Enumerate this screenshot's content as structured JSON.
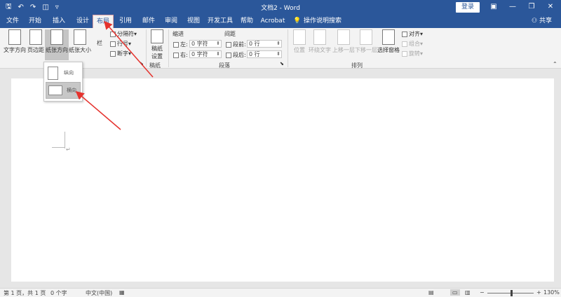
{
  "window": {
    "title": "文档2 - Word",
    "login_label": "登录",
    "quick_access": [
      "save-icon",
      "undo-icon",
      "redo-icon",
      "touch-mode-icon",
      "customize-icon"
    ],
    "controls": [
      "ribbon-display-icon",
      "minimize-icon",
      "restore-icon",
      "close-icon"
    ]
  },
  "tabs": [
    {
      "label": "文件"
    },
    {
      "label": "开始"
    },
    {
      "label": "插入"
    },
    {
      "label": "设计"
    },
    {
      "label": "布局",
      "active": true
    },
    {
      "label": "引用"
    },
    {
      "label": "邮件"
    },
    {
      "label": "审阅"
    },
    {
      "label": "视图"
    },
    {
      "label": "开发工具"
    },
    {
      "label": "帮助"
    },
    {
      "label": "Acrobat"
    }
  ],
  "tell_me": "操作说明搜索",
  "share_label": "共享",
  "ribbon": {
    "page_setup": {
      "text_direction": "文字方向",
      "margins": "页边距",
      "orientation": "纸张方向",
      "size": "纸张大小",
      "columns": "栏",
      "breaks": "分隔符",
      "line_numbers": "行号",
      "hyphenation": "断字"
    },
    "manuscript": {
      "button": "稿纸设置",
      "group_label": "稿纸"
    },
    "paragraph": {
      "indent_header": "缩进",
      "spacing_header": "间距",
      "left_label": "左:",
      "right_label": "右:",
      "before_label": "段前:",
      "after_label": "段后:",
      "left_value": "0 字符",
      "right_value": "0 字符",
      "before_value": "0 行",
      "after_value": "0 行",
      "group_label": "段落"
    },
    "arrange": {
      "position": "位置",
      "wrap_text": "环绕文字",
      "bring_forward": "上移一层",
      "send_backward": "下移一层",
      "selection_pane": "选择窗格",
      "align": "对齐",
      "group": "组合",
      "rotate": "旋转",
      "group_label": "排列"
    }
  },
  "orientation_menu": {
    "portrait": "纵向",
    "landscape": "横向"
  },
  "statusbar": {
    "page_info": "第 1 页，共 1 页",
    "word_count": "0 个字",
    "language": "中文(中国)",
    "zoom": "130%"
  },
  "colors": {
    "accent": "#2b579a",
    "annotation_arrow": "#e5322d"
  }
}
